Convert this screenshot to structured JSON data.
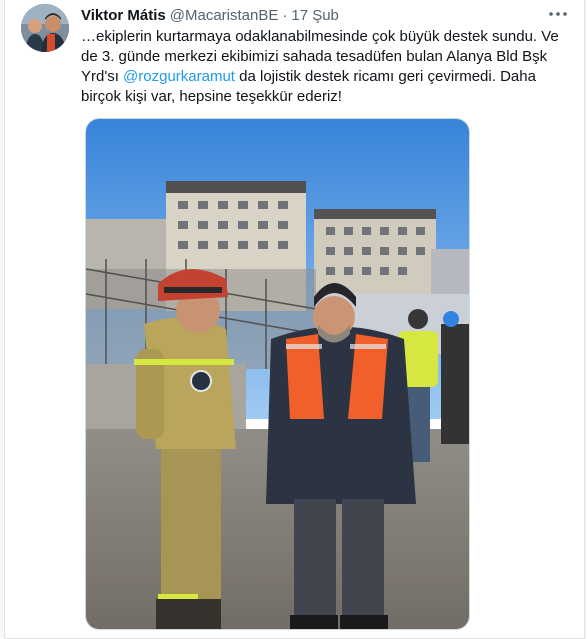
{
  "tweet": {
    "author_name": "Viktor Mátis",
    "author_handle": "@MacaristanBE",
    "separator": "·",
    "date": "17 Şub",
    "text_part1": "…ekiplerin kurtarmaya odaklanabilmesinde çok büyük destek sundu. Ve de 3. günde merkezi ekibimizi sahada tesadüfen bulan Alanya Bld Bşk Yrd'sı ",
    "mention": "@rozgurkaramut",
    "text_part2": " da lojistik destek ricamı geri çevirmedi. Daha birçok kişi var, hepsine teşekkür ederiz!"
  },
  "icons": {
    "more": "more-icon",
    "avatar": "profile-avatar"
  },
  "colors": {
    "link": "#1d9bf0",
    "secondary_text": "#536471",
    "sky": "#3f8ee0",
    "safety_orange": "#f15a22",
    "hivis_yellow": "#d6e63a"
  }
}
